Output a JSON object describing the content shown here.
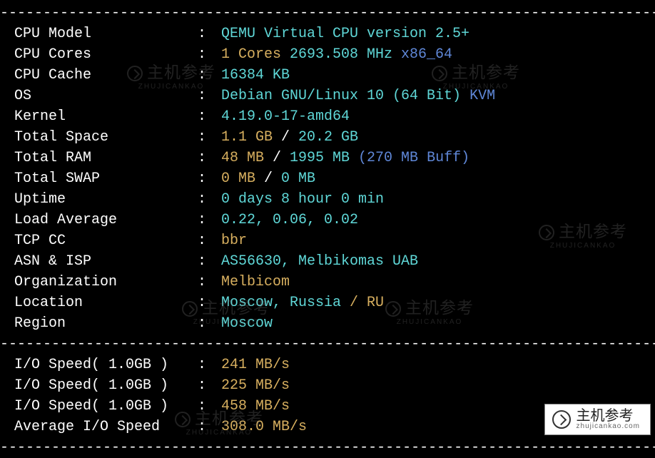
{
  "divider": "----------------------------------------------------------------------------------",
  "rows": [
    {
      "label": "CPU Model",
      "parts": [
        {
          "text": "QEMU Virtual CPU version 2.5+",
          "cls": "cyan"
        }
      ]
    },
    {
      "label": "CPU Cores",
      "parts": [
        {
          "text": "1 Cores",
          "cls": "yellow"
        },
        {
          "text": " 2693.508 MHz ",
          "cls": "cyan"
        },
        {
          "text": "x86_64",
          "cls": "blue"
        }
      ]
    },
    {
      "label": "CPU Cache",
      "parts": [
        {
          "text": "16384 KB",
          "cls": "cyan"
        }
      ]
    },
    {
      "label": "OS",
      "parts": [
        {
          "text": "Debian GNU/Linux 10 (64 Bit)",
          "cls": "cyan"
        },
        {
          "text": " KVM",
          "cls": "blue"
        }
      ]
    },
    {
      "label": "Kernel",
      "parts": [
        {
          "text": "4.19.0-17-amd64",
          "cls": "cyan"
        }
      ]
    },
    {
      "label": "Total Space",
      "parts": [
        {
          "text": "1.1 GB",
          "cls": "yellow"
        },
        {
          "text": " / ",
          "cls": "white"
        },
        {
          "text": "20.2 GB",
          "cls": "cyan"
        }
      ]
    },
    {
      "label": "Total RAM",
      "parts": [
        {
          "text": "48 MB",
          "cls": "yellow"
        },
        {
          "text": " / ",
          "cls": "white"
        },
        {
          "text": "1995 MB",
          "cls": "cyan"
        },
        {
          "text": " (270 MB Buff)",
          "cls": "blue"
        }
      ]
    },
    {
      "label": "Total SWAP",
      "parts": [
        {
          "text": "0 MB",
          "cls": "yellow"
        },
        {
          "text": " / ",
          "cls": "white"
        },
        {
          "text": "0 MB",
          "cls": "cyan"
        }
      ]
    },
    {
      "label": "Uptime",
      "parts": [
        {
          "text": "0 days 8 hour 0 min",
          "cls": "cyan"
        }
      ]
    },
    {
      "label": "Load Average",
      "parts": [
        {
          "text": "0.22, 0.06, 0.02",
          "cls": "cyan"
        }
      ]
    },
    {
      "label": "TCP CC",
      "parts": [
        {
          "text": "bbr",
          "cls": "yellow"
        }
      ]
    },
    {
      "label": "ASN & ISP",
      "parts": [
        {
          "text": "AS56630, Melbikomas UAB",
          "cls": "cyan"
        }
      ]
    },
    {
      "label": "Organization",
      "parts": [
        {
          "text": "Melbicom",
          "cls": "yellow"
        }
      ]
    },
    {
      "label": "Location",
      "parts": [
        {
          "text": "Moscow, Russia",
          "cls": "cyan"
        },
        {
          "text": " / RU",
          "cls": "yellow"
        }
      ]
    },
    {
      "label": "Region",
      "parts": [
        {
          "text": "Moscow",
          "cls": "cyan"
        }
      ]
    }
  ],
  "io_rows": [
    {
      "label": "I/O Speed( 1.0GB )",
      "parts": [
        {
          "text": "241 MB/s",
          "cls": "yellow"
        }
      ]
    },
    {
      "label": "I/O Speed( 1.0GB )",
      "parts": [
        {
          "text": "225 MB/s",
          "cls": "yellow"
        }
      ]
    },
    {
      "label": "I/O Speed( 1.0GB )",
      "parts": [
        {
          "text": "458 MB/s",
          "cls": "yellow"
        }
      ]
    },
    {
      "label": "Average I/O Speed",
      "parts": [
        {
          "text": "308.0 MB/s",
          "cls": "yellow"
        }
      ]
    }
  ],
  "watermark": {
    "main": "主机参考",
    "sub": "ZHUJICANKAO",
    "url": "zhujicankao.com"
  }
}
